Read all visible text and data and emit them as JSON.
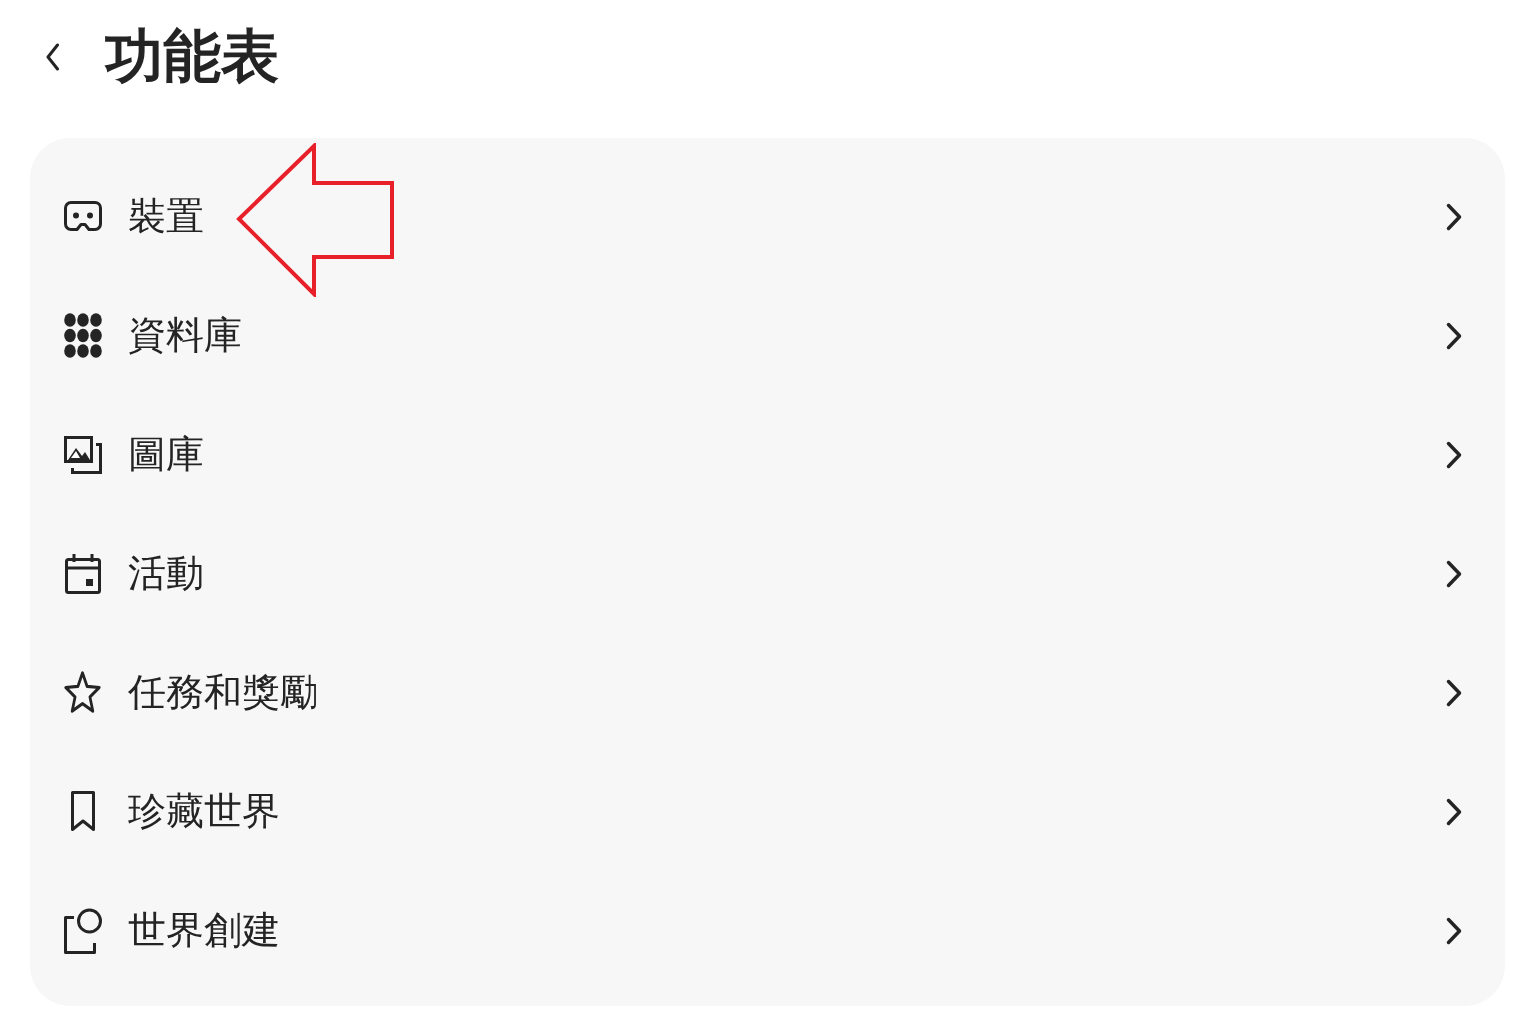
{
  "header": {
    "title": "功能表"
  },
  "menu": {
    "items": [
      {
        "kind": "devices",
        "label": "裝置",
        "annotated": true
      },
      {
        "kind": "library",
        "label": "資料庫",
        "annotated": false
      },
      {
        "kind": "gallery",
        "label": "圖庫",
        "annotated": false
      },
      {
        "kind": "events",
        "label": "活動",
        "annotated": false
      },
      {
        "kind": "quests",
        "label": "任務和獎勵",
        "annotated": false
      },
      {
        "kind": "favorites",
        "label": "珍藏世界",
        "annotated": false
      },
      {
        "kind": "create",
        "label": "世界創建",
        "annotated": false
      }
    ]
  }
}
